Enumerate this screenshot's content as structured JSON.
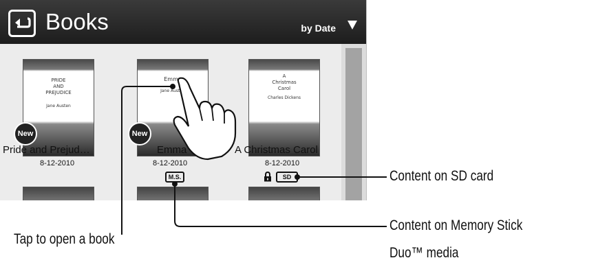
{
  "header": {
    "title": "Books",
    "sort_label": "by Date"
  },
  "books": [
    {
      "title": "Pride and Prejud…",
      "date": "8-12-2010",
      "new_badge": "New",
      "cover_title": "PRIDE\nAND\nPREJUDICE",
      "cover_author": "Jane Austen"
    },
    {
      "title": "Emma",
      "date": "8-12-2010",
      "new_badge": "New",
      "cover_title": "Emma",
      "cover_author": "Jane Austen",
      "storage_badge": "M.S."
    },
    {
      "title": "A Christmas Carol",
      "date": "8-12-2010",
      "cover_title": "A\nChristmas\nCarol",
      "cover_author": "Charles Dickens",
      "storage_badge": "SD"
    }
  ],
  "callouts": {
    "sd_card": "Content on SD card",
    "memory_stick_line1": "Content on Memory Stick",
    "memory_stick_line2": "Duo™ media",
    "tap_to_open": "Tap to open a book"
  },
  "icons": [
    "back-icon",
    "dropdown-arrow-icon",
    "lock-icon",
    "hand-pointer-icon"
  ]
}
